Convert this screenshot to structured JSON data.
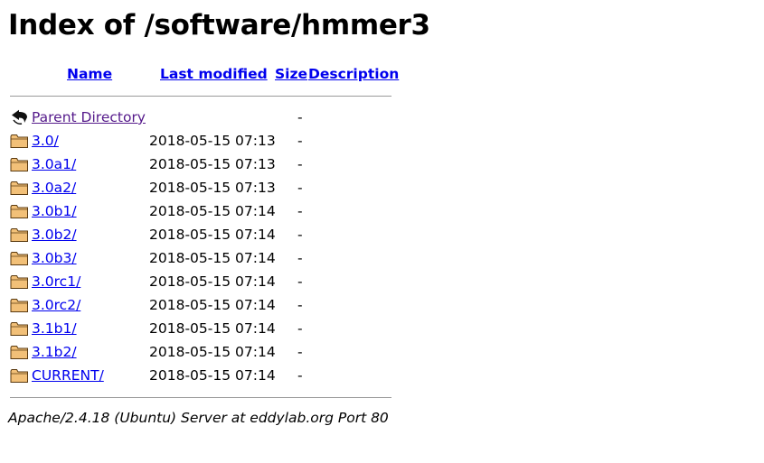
{
  "page": {
    "title": "Index of /software/hmmer3"
  },
  "columns": {
    "name": "Name",
    "last_modified": "Last modified",
    "size": "Size",
    "description": "Description"
  },
  "rows": [
    {
      "name": "Parent Directory",
      "modified": "",
      "size": "-",
      "icon": "back-icon"
    },
    {
      "name": "3.0/",
      "modified": "2018-05-15 07:13",
      "size": "-",
      "icon": "folder-icon"
    },
    {
      "name": "3.0a1/",
      "modified": "2018-05-15 07:13",
      "size": "-",
      "icon": "folder-icon"
    },
    {
      "name": "3.0a2/",
      "modified": "2018-05-15 07:13",
      "size": "-",
      "icon": "folder-icon"
    },
    {
      "name": "3.0b1/",
      "modified": "2018-05-15 07:14",
      "size": "-",
      "icon": "folder-icon"
    },
    {
      "name": "3.0b2/",
      "modified": "2018-05-15 07:14",
      "size": "-",
      "icon": "folder-icon"
    },
    {
      "name": "3.0b3/",
      "modified": "2018-05-15 07:14",
      "size": "-",
      "icon": "folder-icon"
    },
    {
      "name": "3.0rc1/",
      "modified": "2018-05-15 07:14",
      "size": "-",
      "icon": "folder-icon"
    },
    {
      "name": "3.0rc2/",
      "modified": "2018-05-15 07:14",
      "size": "-",
      "icon": "folder-icon"
    },
    {
      "name": "3.1b1/",
      "modified": "2018-05-15 07:14",
      "size": "-",
      "icon": "folder-icon"
    },
    {
      "name": "3.1b2/",
      "modified": "2018-05-15 07:14",
      "size": "-",
      "icon": "folder-icon"
    },
    {
      "name": "CURRENT/",
      "modified": "2018-05-15 07:14",
      "size": "-",
      "icon": "folder-icon"
    }
  ],
  "footer": {
    "server": "Apache/2.4.18 (Ubuntu) Server at eddylab.org Port 80"
  },
  "colors": {
    "link": "#0000ee",
    "visited_link": "#551a8b",
    "rule": "#9a9a9a",
    "folder_fill": "#f2c078",
    "folder_stroke": "#5a3a10"
  }
}
